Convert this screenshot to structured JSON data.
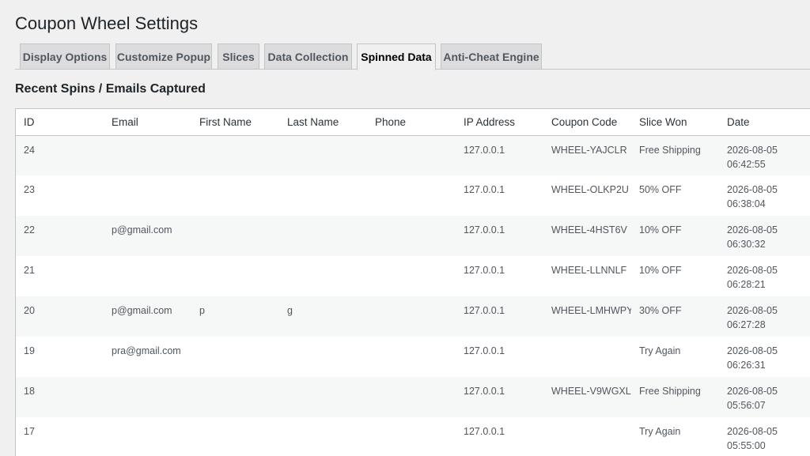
{
  "page_title": "Coupon Wheel Settings",
  "tabs": [
    {
      "label": "Display Options"
    },
    {
      "label": "Customize Popup"
    },
    {
      "label": "Slices"
    },
    {
      "label": "Data Collection"
    },
    {
      "label": "Spinned Data",
      "active": true
    },
    {
      "label": "Anti-Cheat Engine"
    }
  ],
  "section_title": "Recent Spins / Emails Captured",
  "table": {
    "headers": [
      "ID",
      "Email",
      "First Name",
      "Last Name",
      "Phone",
      "IP Address",
      "Coupon Code",
      "Slice Won",
      "Date"
    ],
    "rows": [
      {
        "id": "24",
        "email": "",
        "first_name": "",
        "last_name": "",
        "phone": "",
        "ip": "127.0.0.1",
        "coupon": "WHEEL-YAJCLR",
        "slice": "Free Shipping",
        "date": "2026-08-05",
        "time": "06:42:55"
      },
      {
        "id": "23",
        "email": "",
        "first_name": "",
        "last_name": "",
        "phone": "",
        "ip": "127.0.0.1",
        "coupon": "WHEEL-OLKP2U",
        "slice": "50% OFF",
        "date": "2026-08-05",
        "time": "06:38:04"
      },
      {
        "id": "22",
        "email": "p@gmail.com",
        "first_name": "",
        "last_name": "",
        "phone": "",
        "ip": "127.0.0.1",
        "coupon": "WHEEL-4HST6V",
        "slice": "10% OFF",
        "date": "2026-08-05",
        "time": "06:30:32"
      },
      {
        "id": "21",
        "email": "",
        "first_name": "",
        "last_name": "",
        "phone": "",
        "ip": "127.0.0.1",
        "coupon": "WHEEL-LLNNLF",
        "slice": "10% OFF",
        "date": "2026-08-05",
        "time": "06:28:21"
      },
      {
        "id": "20",
        "email": "p@gmail.com",
        "first_name": "p",
        "last_name": "g",
        "phone": "",
        "ip": "127.0.0.1",
        "coupon": "WHEEL-LMHWPY",
        "slice": "30% OFF",
        "date": "2026-08-05",
        "time": "06:27:28"
      },
      {
        "id": "19",
        "email": "pra@gmail.com",
        "first_name": "",
        "last_name": "",
        "phone": "",
        "ip": "127.0.0.1",
        "coupon": "",
        "slice": "Try Again",
        "date": "2026-08-05",
        "time": "06:26:31"
      },
      {
        "id": "18",
        "email": "",
        "first_name": "",
        "last_name": "",
        "phone": "",
        "ip": "127.0.0.1",
        "coupon": "WHEEL-V9WGXL",
        "slice": "Free Shipping",
        "date": "2026-08-05",
        "time": "05:56:07"
      },
      {
        "id": "17",
        "email": "",
        "first_name": "",
        "last_name": "",
        "phone": "",
        "ip": "127.0.0.1",
        "coupon": "",
        "slice": "Try Again",
        "date": "2026-08-05",
        "time": "05:55:00"
      }
    ]
  }
}
